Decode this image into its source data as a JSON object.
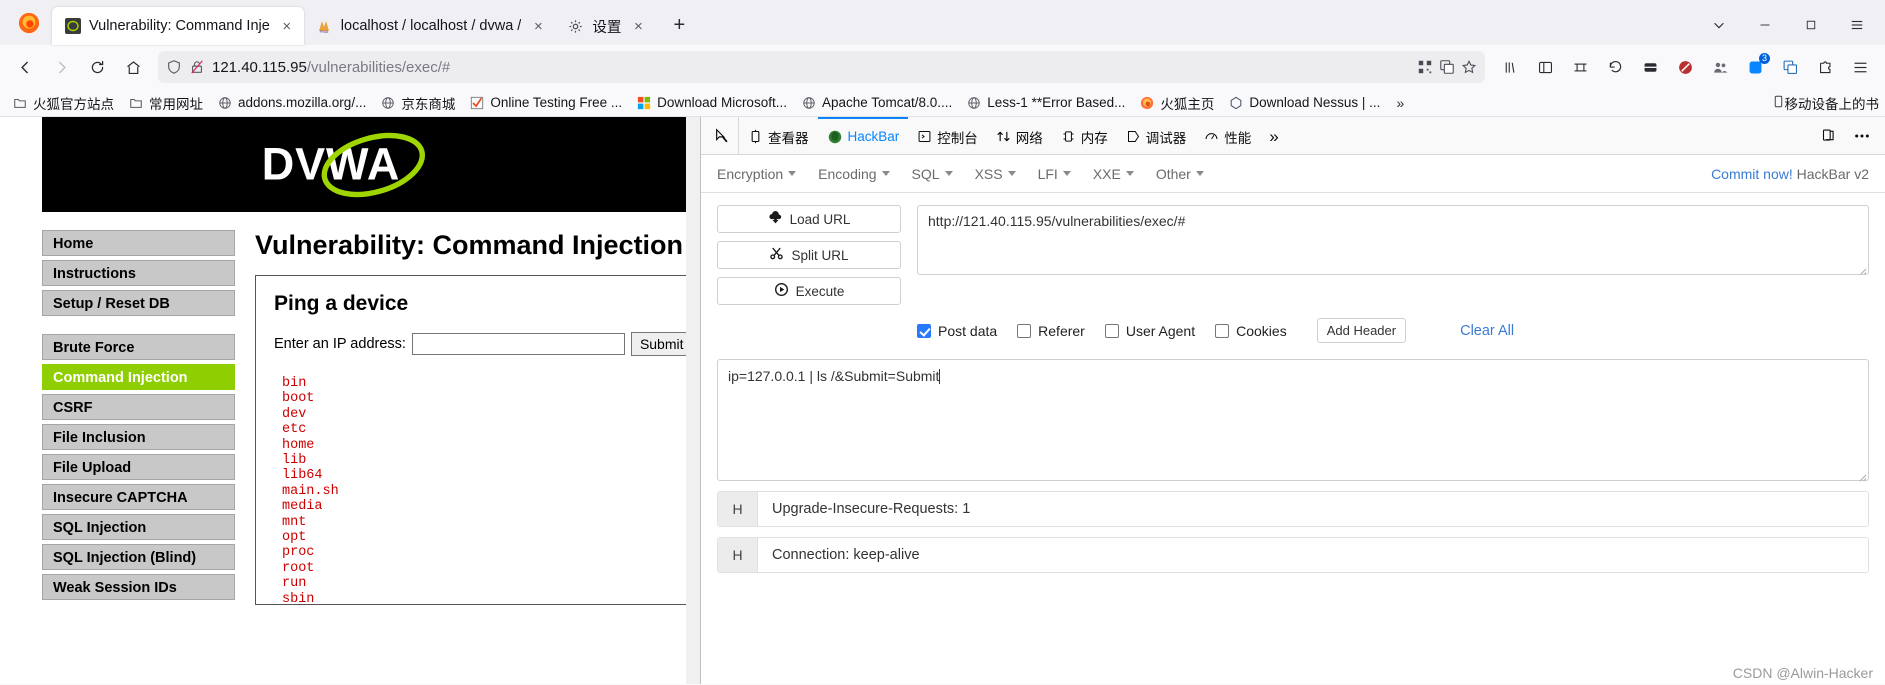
{
  "browser": {
    "tabs": [
      {
        "title": "Vulnerability: Command Inje",
        "favicon": "dvwa-icon",
        "active": true,
        "close": "×"
      },
      {
        "title": "localhost / localhost / dvwa /",
        "favicon": "phpmyadmin-icon",
        "active": false,
        "close": "×"
      },
      {
        "title": "设置",
        "favicon": "gear-icon",
        "active": false,
        "close": "×"
      }
    ],
    "new_tab_label": "+",
    "window_controls": {
      "list_all_tabs": "⌄",
      "minimize": "—",
      "maximize": "❐",
      "menu": "≡"
    },
    "nav": {
      "back": "←",
      "forward": "→",
      "reload": "↻",
      "home": "⌂",
      "url_host": "121.40.115.95",
      "url_path": "/vulnerabilities/exec/#",
      "shield_icon": "shield-icon",
      "lock_broken_icon": "lock-broken-icon",
      "qr_icon": "qr-code-icon",
      "translate_icon": "translate-icon",
      "bookmark_star_icon": "star-icon",
      "library_icon": "library-icon",
      "sidebar_icon": "sidebar-icon",
      "container_icon": "container-icon",
      "undo_icon": "undo-icon",
      "pocket_icon": "pocket-icon",
      "shield_block_icon": "shield-block-icon",
      "people_icon": "people-icon",
      "extension_count": "3",
      "translate2_icon": "translate-icon",
      "extension_icon": "extension-icon",
      "app_menu_icon": "hamburger-menu-icon"
    },
    "bookmarks": [
      {
        "label": "火狐官方站点",
        "icon": "folder-icon"
      },
      {
        "label": "常用网址",
        "icon": "folder-icon"
      },
      {
        "label": "addons.mozilla.org/...",
        "icon": "globe-icon"
      },
      {
        "label": "京东商城",
        "icon": "globe-icon"
      },
      {
        "label": "Online Testing Free ...",
        "icon": "checkmark-icon"
      },
      {
        "label": "Download Microsoft...",
        "icon": "microsoft-icon"
      },
      {
        "label": "Apache Tomcat/8.0....",
        "icon": "globe-icon"
      },
      {
        "label": "Less-1 **Error Based...",
        "icon": "globe-icon"
      },
      {
        "label": "火狐主页",
        "icon": "firefox-icon"
      },
      {
        "label": "Download Nessus | ...",
        "icon": "nessus-icon"
      }
    ],
    "bookmarks_overflow": "»",
    "bookmarks_right": {
      "label": "移动设备上的书",
      "icon": "mobile-icon"
    }
  },
  "dvwa": {
    "logo_text": "DVWA",
    "sidebar": [
      {
        "label": "Home",
        "active": false
      },
      {
        "label": "Instructions",
        "active": false
      },
      {
        "label": "Setup / Reset DB",
        "active": false
      },
      {
        "label": "Brute Force",
        "active": false
      },
      {
        "label": "Command Injection",
        "active": true
      },
      {
        "label": "CSRF",
        "active": false
      },
      {
        "label": "File Inclusion",
        "active": false
      },
      {
        "label": "File Upload",
        "active": false
      },
      {
        "label": "Insecure CAPTCHA",
        "active": false
      },
      {
        "label": "SQL Injection",
        "active": false
      },
      {
        "label": "SQL Injection (Blind)",
        "active": false
      },
      {
        "label": "Weak Session IDs",
        "active": false
      }
    ],
    "page_title": "Vulnerability: Command Injection",
    "box_title": "Ping a device",
    "form_label": "Enter an IP address:",
    "ip_value": "",
    "ip_placeholder": "",
    "submit_label": "Submit",
    "output": "bin\nboot\ndev\netc\nhome\nlib\nlib64\nmain.sh\nmedia\nmnt\nopt\nproc\nroot\nrun\nsbin"
  },
  "devtools": {
    "picker_icon": "element-picker-icon",
    "tabs": [
      {
        "label": "查看器",
        "icon": "inspector-icon",
        "active": false
      },
      {
        "label": "HackBar",
        "icon": "hackbar-icon",
        "active": true
      },
      {
        "label": "控制台",
        "icon": "console-icon",
        "active": false
      },
      {
        "label": "网络",
        "icon": "network-icon",
        "active": false
      },
      {
        "label": "内存",
        "icon": "memory-icon",
        "active": false
      },
      {
        "label": "调试器",
        "icon": "debugger-icon",
        "active": false
      },
      {
        "label": "性能",
        "icon": "performance-icon",
        "active": false
      }
    ],
    "overflow": "»",
    "dock_icon": "dock-panel-icon",
    "more_icon": "more-options-icon"
  },
  "hackbar": {
    "menus": [
      {
        "label": "Encryption"
      },
      {
        "label": "Encoding"
      },
      {
        "label": "SQL"
      },
      {
        "label": "XSS"
      },
      {
        "label": "LFI"
      },
      {
        "label": "XXE"
      },
      {
        "label": "Other"
      }
    ],
    "commit_text": "Commit now!",
    "version_text": "HackBar v2",
    "buttons": [
      {
        "label": "Load URL",
        "icon": "cloud-download-icon"
      },
      {
        "label": "Split URL",
        "icon": "scissors-icon"
      },
      {
        "label": "Execute",
        "icon": "play-circle-icon"
      }
    ],
    "url_value": "http://121.40.115.95/vulnerabilities/exec/#",
    "checkboxes": [
      {
        "label": "Post data",
        "checked": true
      },
      {
        "label": "Referer",
        "checked": false
      },
      {
        "label": "User Agent",
        "checked": false
      },
      {
        "label": "Cookies",
        "checked": false
      }
    ],
    "add_header_label": "Add Header",
    "clear_all_label": "Clear All",
    "post_data": "ip=127.0.0.1 | ls /&Submit=Submit",
    "headers": [
      {
        "key": "H",
        "value": "Upgrade-Insecure-Requests: 1"
      },
      {
        "key": "H",
        "value": "Connection: keep-alive"
      }
    ]
  },
  "watermark": "CSDN @Alwin-Hacker"
}
